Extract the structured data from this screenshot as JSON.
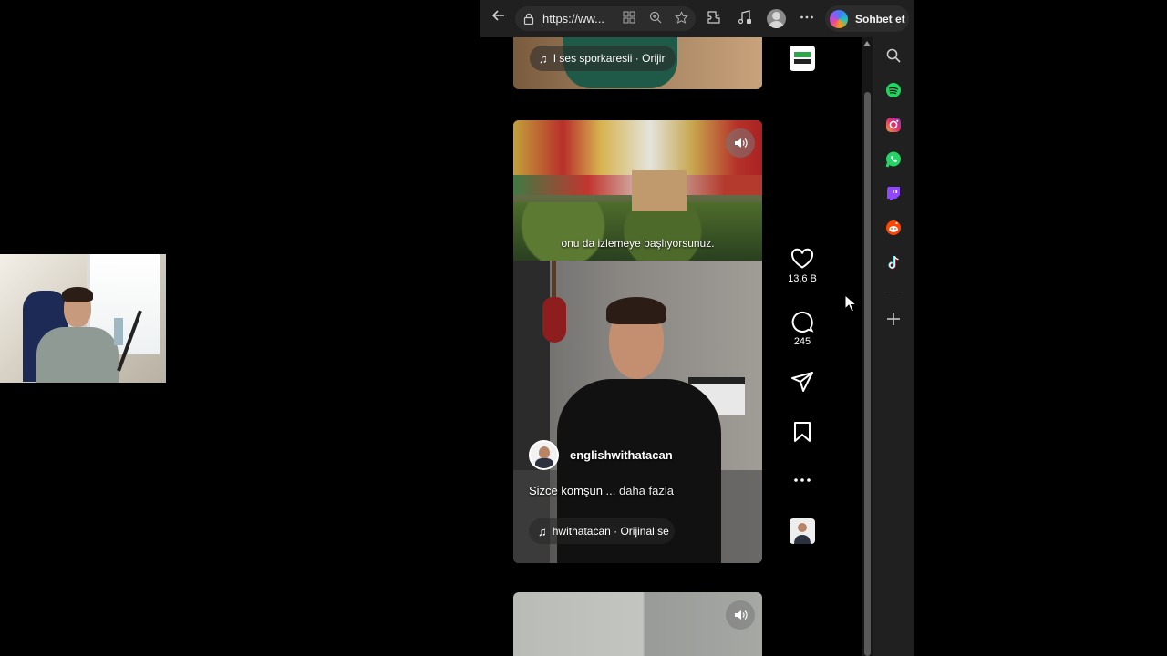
{
  "browser": {
    "url": "https://ww...",
    "copilot_label": "Sohbet et"
  },
  "feed": {
    "top_post": {
      "music": "I ses  sporkaresii · Orijir"
    },
    "main_post": {
      "overlay_caption": "onu da izlemeye başlıyorsunuz.",
      "author": "englishwithatacan",
      "caption": "Sizce komşun",
      "more_label": "... daha fazla",
      "music": "hwithatacan · Orijinal se"
    }
  },
  "actions": {
    "like_count": "13,6 B",
    "comment_count": "245"
  },
  "sidebar": {
    "items": [
      "search-icon",
      "spotify-icon",
      "instagram-icon",
      "whatsapp-icon",
      "twitch-icon",
      "reddit-icon",
      "tiktok-icon",
      "add-icon"
    ]
  },
  "colors": {
    "spotify": "#1ed760",
    "whatsapp": "#25d366",
    "twitch": "#9146ff",
    "reddit": "#ff4500",
    "background": "#000000",
    "toolbar": "#202020"
  }
}
